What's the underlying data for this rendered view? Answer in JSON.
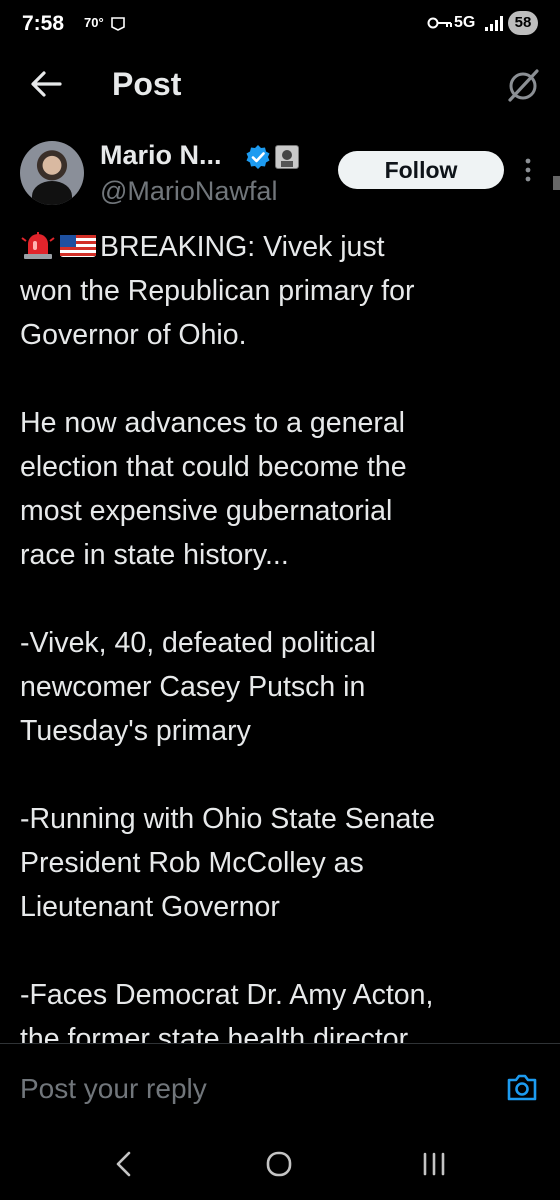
{
  "status_bar": {
    "time": "7:58",
    "temperature": "70°",
    "network": "5G",
    "battery": "58"
  },
  "header": {
    "title": "Post",
    "back_icon": "arrow-left-icon",
    "grok_icon": "grok-icon"
  },
  "post": {
    "author_name": "Mario N...",
    "author_handle": "@MarioNawfal",
    "follow_label": "Follow",
    "text_lines": [
      "BREAKING: Vivek just",
      "won the Republican primary for",
      "Governor of Ohio.",
      "",
      "He now advances to a general",
      "election that could become the",
      "most expensive gubernatorial",
      "race in state history...",
      "",
      "-Vivek, 40, defeated political",
      "newcomer Casey Putsch in",
      "Tuesday's primary",
      "",
      "-Running with Ohio State Senate",
      "President Rob McColley as",
      "Lieutenant Governor",
      "",
      "-Faces Democrat Dr. Amy Acton,",
      "the former state health director"
    ]
  },
  "reply": {
    "placeholder": "Post your reply"
  },
  "colors": {
    "background": "#000000",
    "text": "#e7e9ea",
    "secondary_text": "#71767b",
    "accent": "#1d9bf0"
  }
}
